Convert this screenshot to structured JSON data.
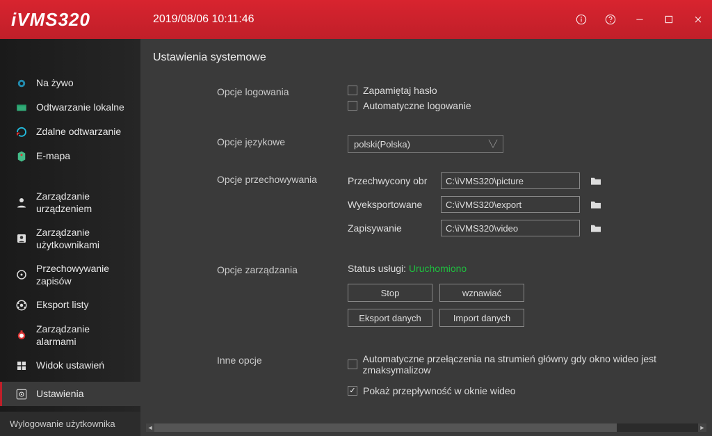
{
  "app": {
    "title": "iVMS320",
    "datetime": "2019/08/06 10:11:46"
  },
  "sidebar": {
    "items": [
      {
        "label": "Na żywo"
      },
      {
        "label": "Odtwarzanie lokalne"
      },
      {
        "label": "Zdalne odtwarzanie"
      },
      {
        "label": "E-mapa"
      },
      {
        "label": "Zarządzanie urządzeniem"
      },
      {
        "label": "Zarządzanie użytkownikami"
      },
      {
        "label": "Przechowywanie zapisów"
      },
      {
        "label": "Eksport listy"
      },
      {
        "label": "Zarządzanie alarmami"
      },
      {
        "label": "Widok ustawień"
      },
      {
        "label": "Ustawienia"
      }
    ],
    "logout": "Wylogowanie użytkownika"
  },
  "main": {
    "title": "Ustawienia systemowe",
    "login": {
      "section": "Opcje logowania",
      "remember": "Zapamiętaj hasło",
      "autologin": "Automatyczne logowanie"
    },
    "language": {
      "section": "Opcje językowe",
      "value": "polski(Polska)"
    },
    "storage": {
      "section": "Opcje przechowywania",
      "captured_label": "Przechwycony obr",
      "captured_path": "C:\\iVMS320\\picture",
      "exported_label": "Wyeksportowane",
      "exported_path": "C:\\iVMS320\\export",
      "record_label": "Zapisywanie",
      "record_path": "C:\\iVMS320\\video"
    },
    "manage": {
      "section": "Opcje zarządzania",
      "status_label": "Status usługi: ",
      "status_value": "Uruchomiono",
      "stop": "Stop",
      "resume": "wznawiać",
      "export": "Eksport danych",
      "import": "Import danych"
    },
    "other": {
      "section": "Inne opcje",
      "autoswitch": "Automatyczne przełączenia na strumień główny gdy okno wideo jest zmaksymalizow",
      "showbitrate": "Pokaż przepływność w oknie wideo"
    }
  }
}
